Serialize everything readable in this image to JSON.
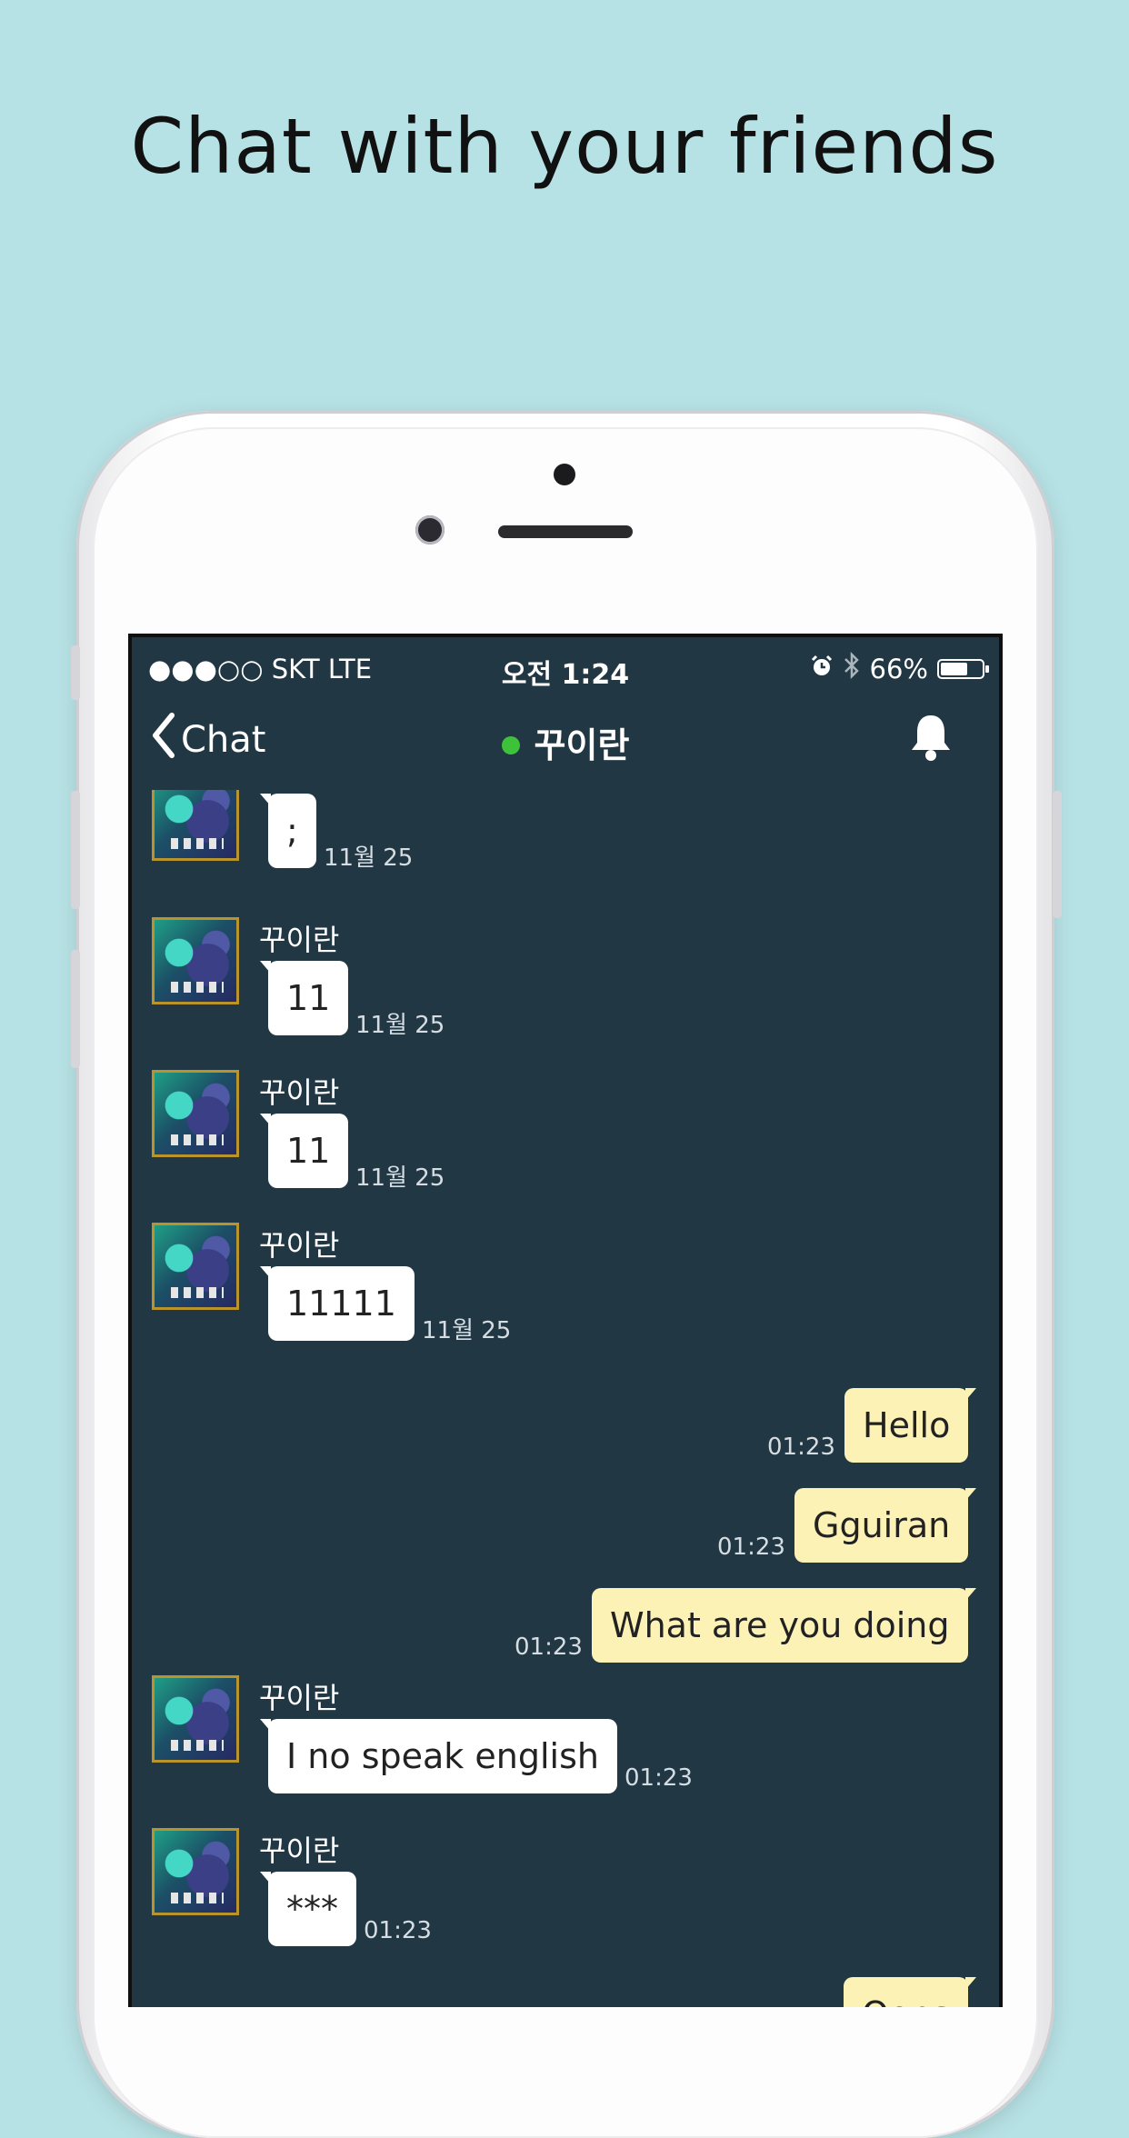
{
  "headline": "Chat with your friends",
  "status_bar": {
    "carrier": "●●●○○ SKT   LTE",
    "time": "오전 1:24",
    "battery": "66%",
    "battery_level": 0.66
  },
  "nav": {
    "back_label": "Chat",
    "contact_name": "꾸이란",
    "online_color": "#3ec23a"
  },
  "colors": {
    "background": "#b7e2e5",
    "screen": "#223744",
    "incoming_bubble": "#ffffff",
    "outgoing_bubble": "#fdf2b5"
  },
  "messages": [
    {
      "direction": "in",
      "sender": "",
      "text": ";",
      "time": "11월 25"
    },
    {
      "direction": "in",
      "sender": "꾸이란",
      "text": "11",
      "time": "11월 25"
    },
    {
      "direction": "in",
      "sender": "꾸이란",
      "text": "11",
      "time": "11월 25"
    },
    {
      "direction": "in",
      "sender": "꾸이란",
      "text": "11111",
      "time": "11월 25"
    },
    {
      "direction": "out",
      "text": "Hello",
      "time": "01:23"
    },
    {
      "direction": "out",
      "text": "Gguiran",
      "time": "01:23"
    },
    {
      "direction": "out",
      "text": "What are you doing",
      "time": "01:23"
    },
    {
      "direction": "in",
      "sender": "꾸이란",
      "text": "I no speak english",
      "time": "01:23"
    },
    {
      "direction": "in",
      "sender": "꾸이란",
      "text": "***",
      "time": "01:23"
    },
    {
      "direction": "out",
      "text": "Oops",
      "time": ""
    }
  ]
}
